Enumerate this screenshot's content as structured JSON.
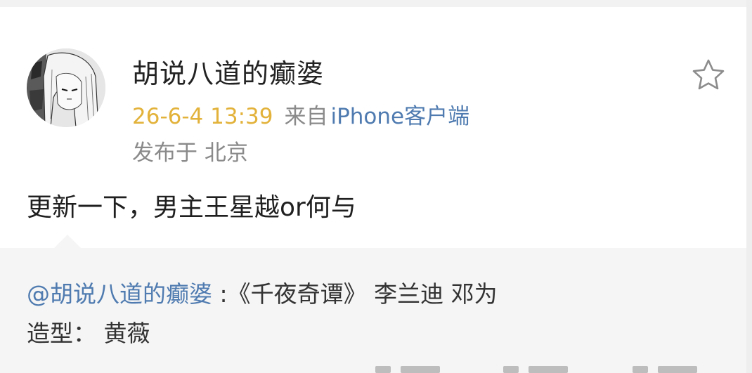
{
  "post": {
    "username": "胡说八道的癫婆",
    "time": "26-6-4 13:39",
    "source_prefix": "来自",
    "source_device": "iPhone客户端",
    "location": "发布于 北京",
    "text": "更新一下，男主王星越or何与"
  },
  "repost": {
    "mention": "@胡说八道的癫婆",
    "line1_rest": " :《千夜奇谭》 李兰迪 邓为",
    "line2": "造型：  黄薇"
  },
  "icons": {
    "favorite": "star-outline-icon",
    "avatar": "avatar-image"
  },
  "colors": {
    "time": "#e2b23a",
    "link": "#4f7bb0",
    "meta_gray": "#8a8a8a",
    "repost_bg": "#f5f5f5"
  }
}
